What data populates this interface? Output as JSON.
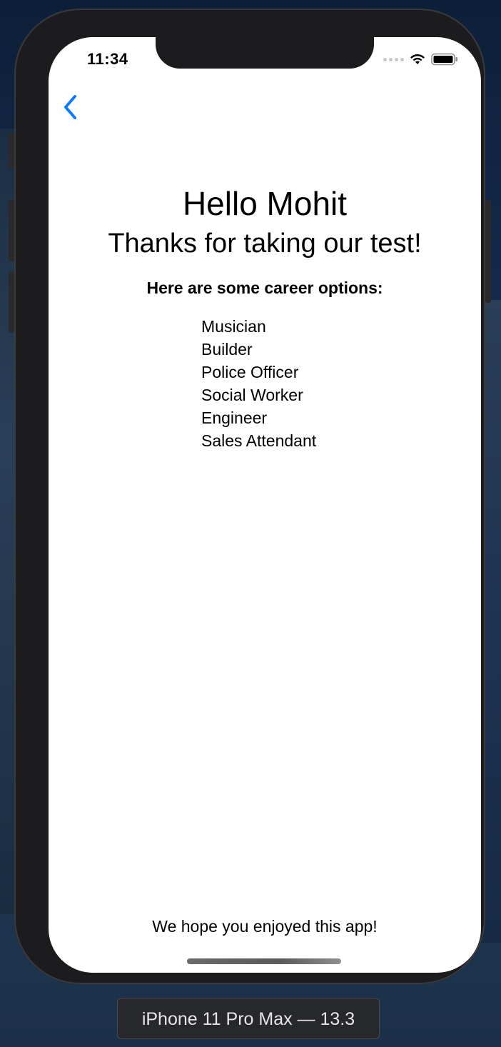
{
  "status_bar": {
    "time": "11:34"
  },
  "nav": {
    "back_icon": "chevron-left-icon",
    "accent_color": "#0a7aff"
  },
  "main": {
    "greeting": "Hello Mohit",
    "thanks": "Thanks for taking our test!",
    "options_heading": "Here are some career options:",
    "careers": [
      "Musician",
      "Builder",
      "Police Officer",
      "Social Worker",
      "Engineer",
      "Sales Attendant"
    ]
  },
  "footer": {
    "message": "We hope you enjoyed this app!"
  },
  "simulator": {
    "device_label": "iPhone 11 Pro Max — 13.3"
  }
}
